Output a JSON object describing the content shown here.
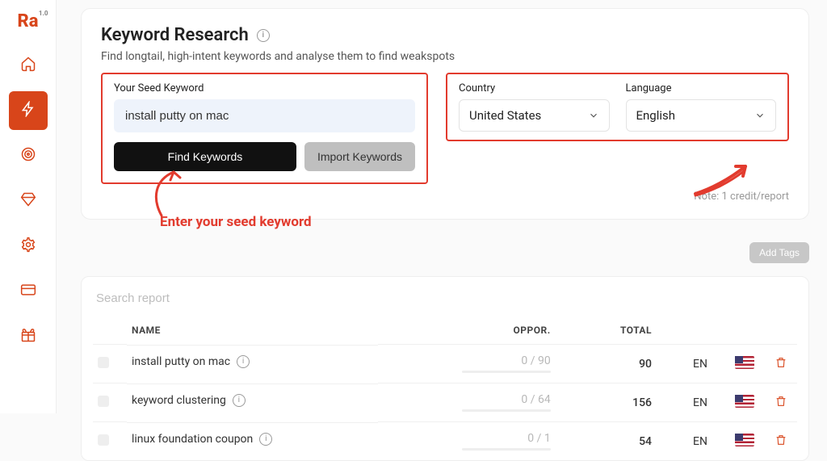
{
  "logo": "Ra",
  "logo_sup": "1.0",
  "sidebar": {
    "items": [
      {
        "name": "home"
      },
      {
        "name": "keyword-research",
        "active": true
      },
      {
        "name": "target"
      },
      {
        "name": "diamond"
      },
      {
        "name": "settings"
      },
      {
        "name": "card"
      },
      {
        "name": "gift"
      }
    ]
  },
  "header": {
    "title": "Keyword Research",
    "subtitle": "Find longtail, high-intent keywords and analyse them to find weakspots"
  },
  "seed_panel": {
    "label": "Your Seed Keyword",
    "value": "install putty on mac",
    "find_btn": "Find Keywords",
    "import_btn": "Import Keywords"
  },
  "locale_panel": {
    "country_label": "Country",
    "country_value": "United States",
    "language_label": "Language",
    "language_value": "English"
  },
  "note": "Note: 1 credit/report",
  "addtags_btn": "Add Tags",
  "annotation_text": "Enter your seed keyword",
  "report": {
    "search_placeholder": "Search report",
    "columns": {
      "name": "NAME",
      "oppor": "OPPOR.",
      "total": "TOTAL"
    },
    "rows": [
      {
        "name": "install putty on mac",
        "oppor": "0 / 90",
        "total": "90",
        "lang": "EN"
      },
      {
        "name": "keyword clustering",
        "oppor": "0 / 64",
        "total": "156",
        "lang": "EN"
      },
      {
        "name": "linux foundation coupon",
        "oppor": "0 / 1",
        "total": "54",
        "lang": "EN"
      }
    ]
  }
}
